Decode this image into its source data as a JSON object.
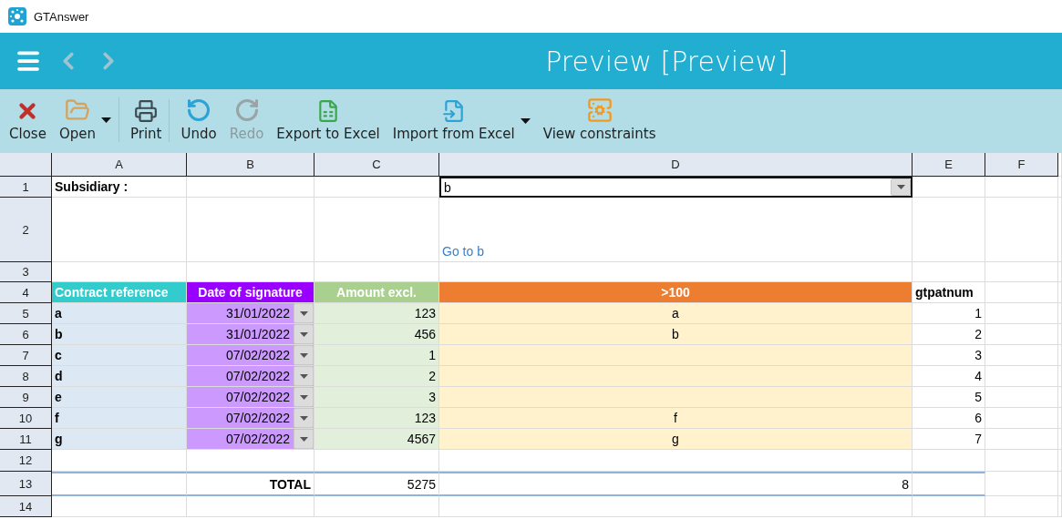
{
  "app": {
    "title": "GTAnswer"
  },
  "header": {
    "title": "Preview [Preview]",
    "back_enabled": false,
    "forward_enabled": false
  },
  "toolbar": [
    {
      "label": "Close",
      "kind": "close",
      "disabled": false,
      "dropdown": false,
      "separator_after": false
    },
    {
      "label": "Open",
      "kind": "open",
      "disabled": false,
      "dropdown": true,
      "separator_after": true
    },
    {
      "label": "Print",
      "kind": "print",
      "disabled": false,
      "dropdown": false,
      "separator_after": true
    },
    {
      "label": "Undo",
      "kind": "undo",
      "disabled": false,
      "dropdown": false,
      "separator_after": false
    },
    {
      "label": "Redo",
      "kind": "redo",
      "disabled": true,
      "dropdown": false,
      "separator_after": false
    },
    {
      "label": "Export to Excel",
      "kind": "export",
      "disabled": false,
      "dropdown": false,
      "separator_after": false
    },
    {
      "label": "Import from Excel",
      "kind": "import",
      "disabled": false,
      "dropdown": true,
      "separator_after": false
    },
    {
      "label": "View constraints",
      "kind": "constraints",
      "disabled": false,
      "dropdown": false,
      "separator_after": false
    }
  ],
  "sheet": {
    "columns": [
      "A",
      "B",
      "C",
      "D",
      "E",
      "F"
    ],
    "row_numbers": [
      "1",
      "2",
      "3",
      "4",
      "5",
      "6",
      "7",
      "8",
      "9",
      "10",
      "11",
      "12",
      "13",
      "14"
    ],
    "subsidiary": {
      "label": "Subsidiary :",
      "value": "b"
    },
    "link": "Go to b",
    "headers": [
      {
        "text": "Contract reference",
        "color": "#33cccc"
      },
      {
        "text": "Date of signature",
        "color": "#9900ff"
      },
      {
        "text": "Amount excl.",
        "color": "#a9d08e"
      },
      {
        "text": ">100",
        "color": "#ed7d31"
      },
      {
        "text": "gtpatnum",
        "color": "#ffffff"
      }
    ],
    "rows": [
      {
        "reference": "a",
        "date": "31/01/2022",
        "amount": "123",
        "flag": "a",
        "gtpatnum": "1"
      },
      {
        "reference": "b",
        "date": "31/01/2022",
        "amount": "456",
        "flag": "b",
        "gtpatnum": "2"
      },
      {
        "reference": "c",
        "date": "07/02/2022",
        "amount": "1",
        "gtpatnum": "3"
      },
      {
        "reference": "d",
        "date": "07/02/2022",
        "amount": "2",
        "gtpatnum": "4"
      },
      {
        "reference": "e",
        "date": "07/02/2022",
        "amount": "3",
        "gtpatnum": "5"
      },
      {
        "reference": "f",
        "date": "07/02/2022",
        "amount": "123",
        "flag": "f",
        "gtpatnum": "6"
      },
      {
        "reference": "g",
        "date": "07/02/2022",
        "amount": "4567",
        "flag": "g",
        "gtpatnum": "7"
      }
    ],
    "total": {
      "label": "TOTAL",
      "amount": "5275",
      "count": "8"
    }
  }
}
